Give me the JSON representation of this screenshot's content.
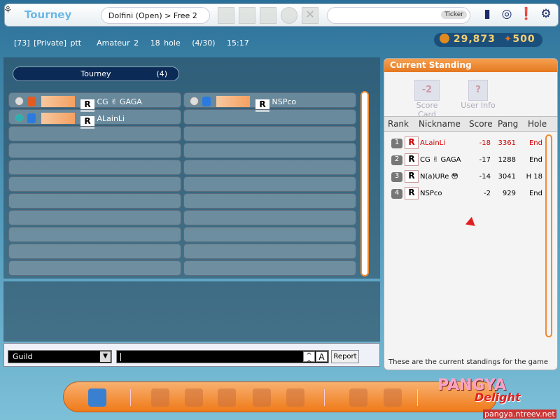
{
  "header": {
    "title": "Tourney",
    "location": "Dolfini (Open) > Free 2",
    "ticker_label": "Ticker"
  },
  "info": {
    "room": "[73] [Private] ptt",
    "level": "Amateur 2",
    "holes": "18 hole",
    "players": "(4/30)",
    "time": "15:17"
  },
  "currency": {
    "pang": "29,873",
    "cookies": "500"
  },
  "lobby": {
    "tab_label": "Tourney",
    "tab_count": "(4)",
    "slots": [
      {
        "col": 0,
        "row": 0,
        "status": "ready",
        "name": "CG ✌ GAGA",
        "rank_icon": "R"
      },
      {
        "col": 1,
        "row": 0,
        "status": "ready",
        "name": "NSPco",
        "rank_icon": "R"
      },
      {
        "col": 0,
        "row": 1,
        "status": "host",
        "name": "ALainLi",
        "rank_icon": "R"
      }
    ]
  },
  "chat": {
    "channel": "Guild",
    "emoticon_label": "^ ^",
    "font_label": "A",
    "report_label": "Report",
    "input_value": ""
  },
  "standing": {
    "title": "Current Standing",
    "scorecard_label": "Score Card",
    "scorecard_value": "-2",
    "userinfo_label": "User Info",
    "columns": [
      "Rank",
      "Nickname",
      "Score",
      "Pang",
      "Hole"
    ],
    "rows": [
      {
        "rank": "1",
        "nickname": "ALainLi",
        "score": "-18",
        "pang": "3361",
        "hole": "End"
      },
      {
        "rank": "2",
        "nickname": "CG ✌ GAGA",
        "score": "-17",
        "pang": "1288",
        "hole": "End"
      },
      {
        "rank": "3",
        "nickname": "N(a)URe 😳",
        "score": "-14",
        "pang": "3041",
        "hole": "H 18"
      },
      {
        "rank": "4",
        "nickname": "NSPco",
        "score": "-2",
        "pang": "929",
        "hole": "End"
      }
    ],
    "footer": "These are the current standings for the game"
  },
  "brand": {
    "logo": "PANGYA",
    "logo2": "Delight",
    "site": "pangya.ntreev.net"
  }
}
